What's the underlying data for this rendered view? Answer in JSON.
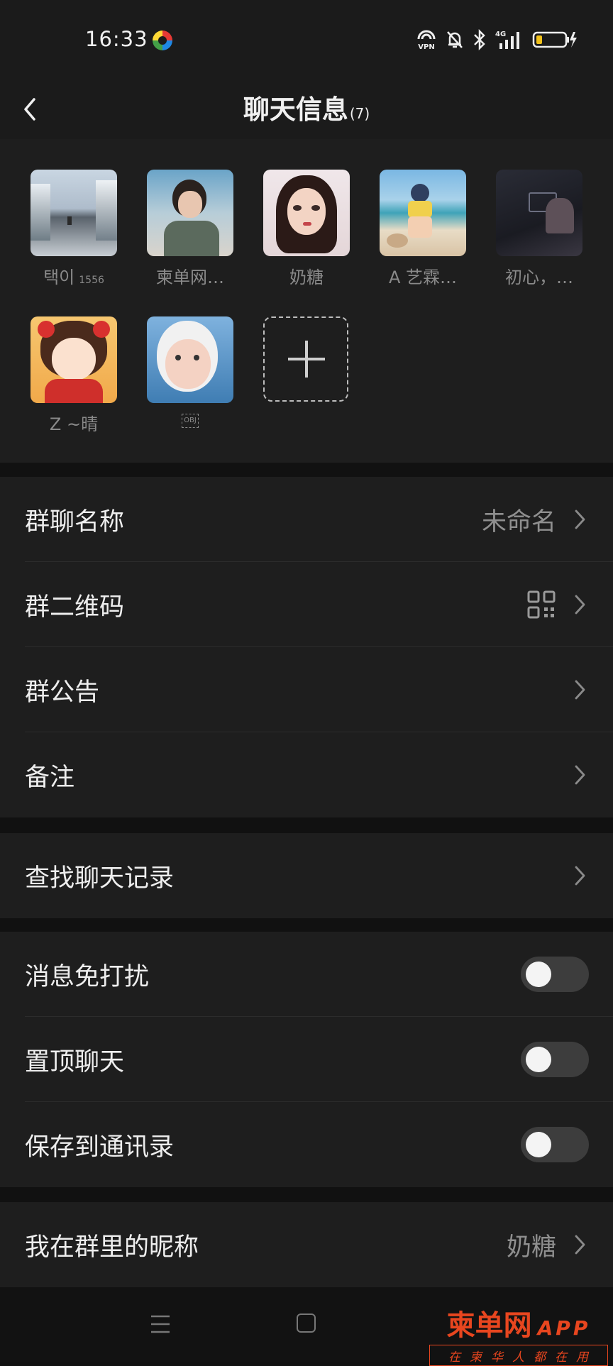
{
  "status_bar": {
    "time": "16:33",
    "vpn_label": "VPN",
    "network": "4G"
  },
  "header": {
    "title": "聊天信息",
    "member_count": "(7)"
  },
  "members": [
    {
      "name": "택이",
      "suffix": "1556"
    },
    {
      "name": "柬单网…",
      "suffix": ""
    },
    {
      "name": "奶糖",
      "suffix": ""
    },
    {
      "name": "A 艺霖…",
      "suffix": ""
    },
    {
      "name": "初心，…",
      "suffix": ""
    },
    {
      "name": "Z ~晴",
      "suffix": ""
    },
    {
      "name": "OBJ",
      "suffix": ""
    }
  ],
  "settings": {
    "group_name": {
      "label": "群聊名称",
      "value": "未命名"
    },
    "group_qr": {
      "label": "群二维码"
    },
    "announcement": {
      "label": "群公告"
    },
    "remark": {
      "label": "备注"
    },
    "search_history": {
      "label": "查找聊天记录"
    },
    "mute": {
      "label": "消息免打扰",
      "on": false
    },
    "pin": {
      "label": "置顶聊天",
      "on": false
    },
    "save_contacts": {
      "label": "保存到通讯录",
      "on": false
    },
    "my_nickname": {
      "label": "我在群里的昵称",
      "value": "奶糖"
    }
  },
  "watermark": {
    "title": "柬单网",
    "app": "APP",
    "tagline": "在柬华人都在用"
  },
  "colors": {
    "background": "#111111",
    "surface": "#1e1e1e",
    "text": "#eeeeee",
    "secondary_text": "#8f8f8f",
    "watermark": "#e8461f"
  }
}
